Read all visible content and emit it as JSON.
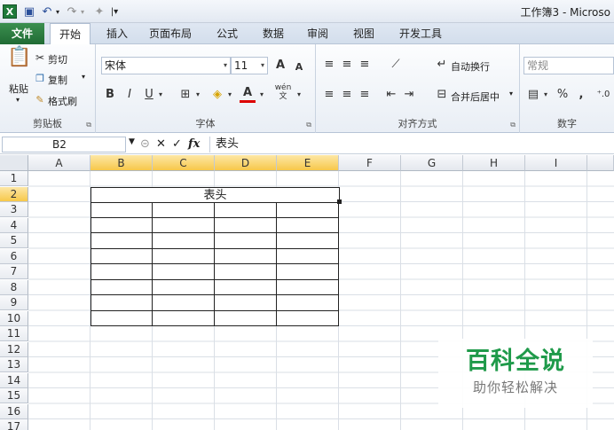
{
  "window": {
    "title": "工作簿3 - Microso"
  },
  "tabs": [
    "文件",
    "开始",
    "插入",
    "页面布局",
    "公式",
    "数据",
    "审阅",
    "视图",
    "开发工具"
  ],
  "ribbon": {
    "clipboard": {
      "paste": "粘贴",
      "cut": "剪切",
      "copy": "复制",
      "format_painter": "格式刷",
      "label": "剪贴板"
    },
    "font": {
      "name": "宋体",
      "size": "11",
      "bold": "B",
      "italic": "I",
      "underline": "U",
      "grow": "A",
      "shrink": "A",
      "wen": "wén",
      "label": "字体"
    },
    "alignment": {
      "wrap": "自动换行",
      "merge": "合并后居中",
      "label": "对齐方式"
    },
    "number": {
      "format": "常规",
      "percent": "%",
      "comma": ",",
      "label": "数字"
    }
  },
  "formula_bar": {
    "cell_ref": "B2",
    "fx": "fx",
    "value": "表头"
  },
  "columns": [
    "A",
    "B",
    "C",
    "D",
    "E",
    "F",
    "G",
    "H",
    "I"
  ],
  "rows": [
    "1",
    "2",
    "3",
    "4",
    "5",
    "6",
    "7",
    "8",
    "9",
    "10",
    "11",
    "12",
    "13",
    "14",
    "15",
    "16",
    "17"
  ],
  "cell_B2": "表头",
  "watermark": {
    "title": "百科全说",
    "subtitle": "助你轻松解决"
  },
  "colors": {
    "file_tab": "#206b34",
    "selected_header": "#f7c84a",
    "watermark": "#1f9a4a"
  }
}
